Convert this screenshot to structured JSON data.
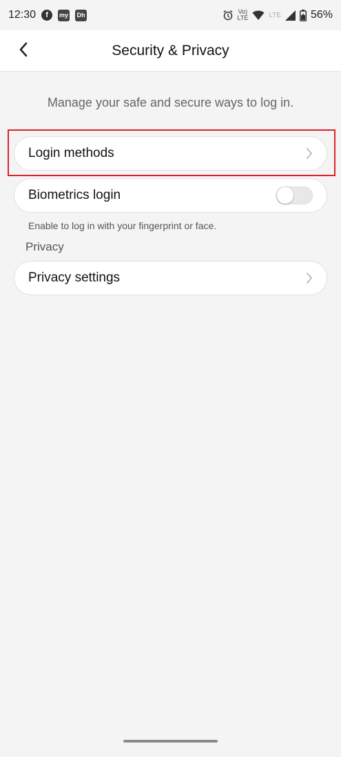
{
  "status_bar": {
    "time": "12:30",
    "notification_icons": [
      "facebook-icon",
      "myntra-icon",
      "dailyhunt-icon"
    ],
    "app_badge_1": "my",
    "app_badge_2": "Dh",
    "fb_letter": "f",
    "volte_top": "Vo)",
    "volte_bottom": "LTE",
    "lte": "LTE",
    "battery": "56%"
  },
  "header": {
    "title": "Security & Privacy"
  },
  "main": {
    "subtitle": "Manage your safe and secure ways to log in.",
    "items": [
      {
        "label": "Login methods",
        "control": "chevron"
      },
      {
        "label": "Biometrics login",
        "control": "toggle",
        "toggle_on": false
      }
    ],
    "biometrics_helper": "Enable to log in with your fingerprint or face.",
    "privacy_section": {
      "label": "Privacy",
      "items": [
        {
          "label": "Privacy settings",
          "control": "chevron"
        }
      ]
    }
  },
  "colors": {
    "highlight_border": "#e0212b",
    "background": "#f4f4f4",
    "card": "#ffffff"
  }
}
